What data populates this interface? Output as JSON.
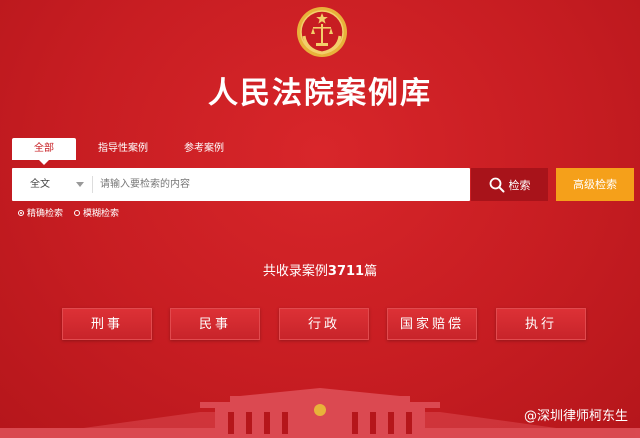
{
  "site": {
    "title": "人民法院案例库"
  },
  "tabs": [
    {
      "label": "全部",
      "active": true
    },
    {
      "label": "指导性案例",
      "active": false
    },
    {
      "label": "参考案例",
      "active": false
    }
  ],
  "search": {
    "scope": "全文",
    "placeholder": "请输入要检索的内容",
    "button": "检索",
    "advanced": "高级检索",
    "modes": [
      {
        "label": "精确检索",
        "checked": true
      },
      {
        "label": "模糊检索",
        "checked": false
      }
    ]
  },
  "stats": {
    "prefix": "共收录案例",
    "count": "3711",
    "suffix": "篇"
  },
  "categories": [
    "刑事",
    "民事",
    "行政",
    "国家赔偿",
    "执行"
  ],
  "watermark": "@深圳律师柯东生",
  "colors": {
    "background": "#c71d22",
    "search_button": "#a8131a",
    "advanced_button": "#f5a01a"
  }
}
